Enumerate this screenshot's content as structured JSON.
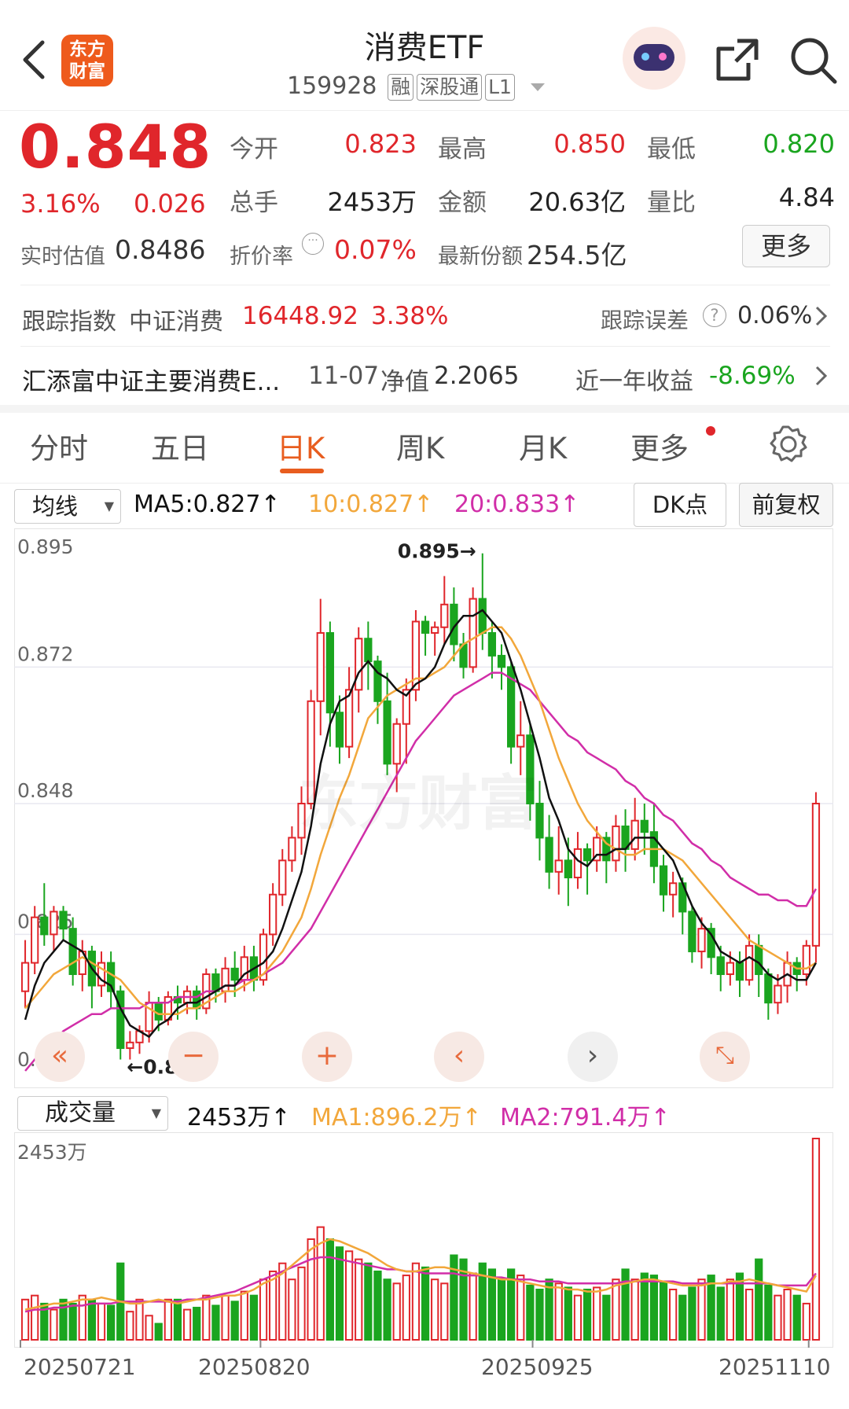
{
  "header": {
    "back_icon": "chevron-left-icon",
    "logo_line1": "东方",
    "logo_line2": "财富",
    "title": "消费ETF",
    "code": "159928",
    "tags": [
      "融",
      "深股通",
      "L1"
    ],
    "share_icon": "share-icon",
    "search_icon": "search-icon"
  },
  "quote": {
    "price": "0.848",
    "change_pct": "3.16%",
    "change_abs": "0.026",
    "open_label": "今开",
    "open": "0.823",
    "high_label": "最高",
    "high": "0.850",
    "low_label": "最低",
    "low": "0.820",
    "vol_label": "总手",
    "vol": "2453万",
    "amount_label": "金额",
    "amount": "20.63亿",
    "ratio_label": "量比",
    "ratio": "4.84",
    "iopv_label": "实时估值",
    "iopv": "0.8486",
    "discount_label": "折价率",
    "discount": "0.07%",
    "shares_label": "最新份额",
    "shares": "254.5亿",
    "more_button": "更多"
  },
  "tracking": {
    "label": "跟踪指数",
    "index_name": "中证消费",
    "index_value": "16448.92",
    "index_pct": "3.38%",
    "error_label": "跟踪误差",
    "error_value": "0.06%"
  },
  "fund": {
    "name": "汇添富中证主要消费E...",
    "nav_date": "11-07",
    "nav_label": "净值",
    "nav": "2.2065",
    "yr_label": "近一年收益",
    "yr_return": "-8.69%"
  },
  "tabs": [
    "分时",
    "五日",
    "日K",
    "周K",
    "月K",
    "更多"
  ],
  "active_tab": "日K",
  "ma_bar": {
    "select": "均线",
    "ma5": "MA5:0.827↑",
    "ma10": "10:0.827↑",
    "ma20": "20:0.833↑",
    "dk_button": "DK点",
    "fq_button": "前复权"
  },
  "volume_bar": {
    "select": "成交量",
    "vol": "2453万↑",
    "ma1": "MA1:896.2万↑",
    "ma2": "MA2:791.4万↑",
    "axis_top": "2453万"
  },
  "colors": {
    "up": "#e0262b",
    "down": "#1aa51f",
    "ma5": "#111111",
    "ma10": "#f2a73b",
    "ma20": "#d12ea8"
  },
  "chart_data": {
    "type": "candlestick",
    "y_ticks": [
      "0.895",
      "0.872",
      "0.848",
      "0.825",
      "0.801"
    ],
    "ylim": [
      0.801,
      0.895
    ],
    "high_annotation": "0.895→",
    "low_annotation": "←0.803",
    "x_labels": [
      "20250721",
      "20250820",
      "20250925",
      "20251110"
    ],
    "candles": [
      [
        0.815,
        0.82,
        0.812,
        0.824
      ],
      [
        0.82,
        0.828,
        0.818,
        0.83
      ],
      [
        0.828,
        0.825,
        0.823,
        0.834
      ],
      [
        0.825,
        0.829,
        0.822,
        0.83
      ],
      [
        0.829,
        0.826,
        0.824,
        0.83
      ],
      [
        0.826,
        0.818,
        0.816,
        0.828
      ],
      [
        0.818,
        0.822,
        0.815,
        0.824
      ],
      [
        0.822,
        0.816,
        0.812,
        0.823
      ],
      [
        0.816,
        0.82,
        0.814,
        0.822
      ],
      [
        0.82,
        0.815,
        0.812,
        0.822
      ],
      [
        0.815,
        0.805,
        0.803,
        0.816
      ],
      [
        0.805,
        0.806,
        0.803,
        0.808
      ],
      [
        0.806,
        0.808,
        0.804,
        0.809
      ],
      [
        0.808,
        0.813,
        0.806,
        0.815
      ],
      [
        0.813,
        0.81,
        0.808,
        0.814
      ],
      [
        0.81,
        0.814,
        0.809,
        0.815
      ],
      [
        0.814,
        0.813,
        0.81,
        0.816
      ],
      [
        0.813,
        0.815,
        0.811,
        0.816
      ],
      [
        0.815,
        0.812,
        0.81,
        0.816
      ],
      [
        0.812,
        0.818,
        0.811,
        0.819
      ],
      [
        0.818,
        0.815,
        0.813,
        0.819
      ],
      [
        0.815,
        0.819,
        0.813,
        0.821
      ],
      [
        0.819,
        0.817,
        0.814,
        0.822
      ],
      [
        0.817,
        0.821,
        0.815,
        0.823
      ],
      [
        0.821,
        0.817,
        0.815,
        0.823
      ],
      [
        0.817,
        0.825,
        0.816,
        0.826
      ],
      [
        0.825,
        0.832,
        0.823,
        0.834
      ],
      [
        0.832,
        0.838,
        0.83,
        0.84
      ],
      [
        0.838,
        0.842,
        0.836,
        0.844
      ],
      [
        0.842,
        0.848,
        0.839,
        0.851
      ],
      [
        0.848,
        0.866,
        0.847,
        0.868
      ],
      [
        0.866,
        0.878,
        0.86,
        0.884
      ],
      [
        0.878,
        0.864,
        0.858,
        0.88
      ],
      [
        0.864,
        0.858,
        0.855,
        0.867
      ],
      [
        0.858,
        0.868,
        0.856,
        0.872
      ],
      [
        0.868,
        0.877,
        0.864,
        0.879
      ],
      [
        0.877,
        0.873,
        0.868,
        0.88
      ],
      [
        0.873,
        0.866,
        0.862,
        0.874
      ],
      [
        0.866,
        0.855,
        0.853,
        0.871
      ],
      [
        0.855,
        0.862,
        0.85,
        0.863
      ],
      [
        0.862,
        0.868,
        0.855,
        0.87
      ],
      [
        0.868,
        0.88,
        0.866,
        0.882
      ],
      [
        0.88,
        0.878,
        0.874,
        0.881
      ],
      [
        0.878,
        0.879,
        0.874,
        0.88
      ],
      [
        0.879,
        0.883,
        0.876,
        0.888
      ],
      [
        0.883,
        0.876,
        0.873,
        0.886
      ],
      [
        0.876,
        0.872,
        0.87,
        0.878
      ],
      [
        0.872,
        0.884,
        0.871,
        0.886
      ],
      [
        0.884,
        0.878,
        0.875,
        0.892
      ],
      [
        0.878,
        0.874,
        0.87,
        0.88
      ],
      [
        0.874,
        0.872,
        0.868,
        0.876
      ],
      [
        0.872,
        0.858,
        0.855,
        0.873
      ],
      [
        0.858,
        0.86,
        0.853,
        0.866
      ],
      [
        0.86,
        0.848,
        0.845,
        0.862
      ],
      [
        0.848,
        0.842,
        0.838,
        0.852
      ],
      [
        0.842,
        0.836,
        0.833,
        0.846
      ],
      [
        0.836,
        0.838,
        0.832,
        0.844
      ],
      [
        0.838,
        0.835,
        0.83,
        0.842
      ],
      [
        0.835,
        0.84,
        0.833,
        0.843
      ],
      [
        0.84,
        0.838,
        0.832,
        0.841
      ],
      [
        0.838,
        0.842,
        0.836,
        0.844
      ],
      [
        0.842,
        0.838,
        0.834,
        0.843
      ],
      [
        0.838,
        0.844,
        0.836,
        0.846
      ],
      [
        0.844,
        0.84,
        0.836,
        0.847
      ],
      [
        0.84,
        0.845,
        0.838,
        0.849
      ],
      [
        0.845,
        0.843,
        0.839,
        0.848
      ],
      [
        0.843,
        0.837,
        0.834,
        0.848
      ],
      [
        0.837,
        0.832,
        0.829,
        0.839
      ],
      [
        0.832,
        0.834,
        0.828,
        0.836
      ],
      [
        0.834,
        0.829,
        0.825,
        0.835
      ],
      [
        0.829,
        0.822,
        0.82,
        0.83
      ],
      [
        0.822,
        0.826,
        0.819,
        0.828
      ],
      [
        0.826,
        0.821,
        0.818,
        0.827
      ],
      [
        0.821,
        0.818,
        0.815,
        0.823
      ],
      [
        0.818,
        0.82,
        0.816,
        0.822
      ],
      [
        0.82,
        0.817,
        0.814,
        0.822
      ],
      [
        0.817,
        0.823,
        0.816,
        0.825
      ],
      [
        0.823,
        0.818,
        0.814,
        0.825
      ],
      [
        0.818,
        0.813,
        0.81,
        0.819
      ],
      [
        0.813,
        0.816,
        0.811,
        0.818
      ],
      [
        0.816,
        0.82,
        0.813,
        0.822
      ],
      [
        0.82,
        0.818,
        0.815,
        0.821
      ],
      [
        0.818,
        0.823,
        0.816,
        0.824
      ],
      [
        0.823,
        0.848,
        0.82,
        0.85
      ]
    ],
    "ma5": [
      0.81,
      0.816,
      0.82,
      0.822,
      0.824,
      0.823,
      0.822,
      0.819,
      0.817,
      0.816,
      0.812,
      0.809,
      0.808,
      0.807,
      0.809,
      0.81,
      0.812,
      0.813,
      0.813,
      0.814,
      0.815,
      0.816,
      0.816,
      0.818,
      0.819,
      0.82,
      0.822,
      0.826,
      0.831,
      0.836,
      0.844,
      0.855,
      0.862,
      0.866,
      0.867,
      0.871,
      0.873,
      0.871,
      0.87,
      0.868,
      0.867,
      0.869,
      0.87,
      0.872,
      0.876,
      0.879,
      0.881,
      0.881,
      0.882,
      0.88,
      0.878,
      0.873,
      0.868,
      0.862,
      0.856,
      0.849,
      0.845,
      0.84,
      0.838,
      0.837,
      0.839,
      0.839,
      0.84,
      0.84,
      0.842,
      0.842,
      0.842,
      0.84,
      0.838,
      0.834,
      0.83,
      0.827,
      0.825,
      0.822,
      0.821,
      0.82,
      0.821,
      0.82,
      0.818,
      0.817,
      0.818,
      0.817,
      0.817,
      0.82
    ],
    "ma10": [
      0.812,
      0.814,
      0.816,
      0.818,
      0.819,
      0.82,
      0.821,
      0.82,
      0.819,
      0.818,
      0.817,
      0.815,
      0.813,
      0.812,
      0.811,
      0.811,
      0.811,
      0.812,
      0.812,
      0.813,
      0.814,
      0.815,
      0.815,
      0.816,
      0.817,
      0.818,
      0.82,
      0.822,
      0.825,
      0.828,
      0.833,
      0.839,
      0.844,
      0.849,
      0.853,
      0.858,
      0.863,
      0.865,
      0.867,
      0.868,
      0.869,
      0.87,
      0.87,
      0.871,
      0.872,
      0.874,
      0.876,
      0.877,
      0.878,
      0.879,
      0.879,
      0.877,
      0.874,
      0.87,
      0.866,
      0.861,
      0.856,
      0.852,
      0.848,
      0.845,
      0.843,
      0.841,
      0.84,
      0.839,
      0.839,
      0.84,
      0.84,
      0.84,
      0.839,
      0.838,
      0.836,
      0.834,
      0.832,
      0.83,
      0.828,
      0.826,
      0.824,
      0.823,
      0.822,
      0.821,
      0.82,
      0.819,
      0.819,
      0.82
    ],
    "ma20": [
      0.801,
      0.803,
      0.805,
      0.806,
      0.808,
      0.809,
      0.81,
      0.811,
      0.811,
      0.812,
      0.812,
      0.812,
      0.812,
      0.813,
      0.813,
      0.813,
      0.814,
      0.814,
      0.814,
      0.815,
      0.815,
      0.816,
      0.816,
      0.817,
      0.817,
      0.818,
      0.819,
      0.82,
      0.822,
      0.824,
      0.826,
      0.829,
      0.832,
      0.835,
      0.838,
      0.841,
      0.844,
      0.847,
      0.85,
      0.853,
      0.856,
      0.859,
      0.861,
      0.863,
      0.865,
      0.867,
      0.868,
      0.869,
      0.87,
      0.871,
      0.871,
      0.87,
      0.869,
      0.868,
      0.866,
      0.864,
      0.862,
      0.86,
      0.859,
      0.857,
      0.856,
      0.855,
      0.854,
      0.852,
      0.851,
      0.849,
      0.848,
      0.846,
      0.845,
      0.843,
      0.841,
      0.84,
      0.838,
      0.837,
      0.835,
      0.834,
      0.833,
      0.832,
      0.832,
      0.831,
      0.831,
      0.83,
      0.83,
      0.833
    ],
    "volume": [
      0.2,
      0.22,
      0.18,
      0.15,
      0.2,
      0.18,
      0.22,
      0.2,
      0.18,
      0.17,
      0.38,
      0.14,
      0.2,
      0.12,
      0.08,
      0.2,
      0.2,
      0.15,
      0.16,
      0.22,
      0.17,
      0.22,
      0.19,
      0.24,
      0.22,
      0.3,
      0.34,
      0.38,
      0.3,
      0.36,
      0.5,
      0.56,
      0.5,
      0.46,
      0.44,
      0.4,
      0.38,
      0.34,
      0.3,
      0.28,
      0.32,
      0.38,
      0.36,
      0.3,
      0.28,
      0.42,
      0.4,
      0.33,
      0.38,
      0.35,
      0.3,
      0.35,
      0.32,
      0.27,
      0.25,
      0.3,
      0.28,
      0.26,
      0.22,
      0.25,
      0.26,
      0.22,
      0.3,
      0.35,
      0.3,
      0.33,
      0.32,
      0.29,
      0.25,
      0.22,
      0.26,
      0.3,
      0.32,
      0.26,
      0.3,
      0.33,
      0.25,
      0.4,
      0.27,
      0.22,
      0.25,
      0.22,
      0.18,
      1.0
    ],
    "volume_ma1": [
      0.15,
      0.16,
      0.17,
      0.18,
      0.18,
      0.19,
      0.2,
      0.2,
      0.21,
      0.2,
      0.19,
      0.18,
      0.18,
      0.19,
      0.2,
      0.19,
      0.18,
      0.19,
      0.2,
      0.2,
      0.21,
      0.22,
      0.22,
      0.23,
      0.25,
      0.28,
      0.3,
      0.33,
      0.37,
      0.41,
      0.45,
      0.48,
      0.5,
      0.49,
      0.47,
      0.45,
      0.43,
      0.4,
      0.37,
      0.35,
      0.34,
      0.34,
      0.35,
      0.36,
      0.36,
      0.35,
      0.34,
      0.33,
      0.32,
      0.31,
      0.3,
      0.3,
      0.29,
      0.28,
      0.27,
      0.26,
      0.26,
      0.25,
      0.25,
      0.24,
      0.24,
      0.25,
      0.27,
      0.28,
      0.29,
      0.3,
      0.3,
      0.29,
      0.28,
      0.27,
      0.27,
      0.27,
      0.28,
      0.28,
      0.29,
      0.29,
      0.3,
      0.29,
      0.28,
      0.27,
      0.26,
      0.25,
      0.24,
      0.32
    ],
    "volume_ma2": [
      0.14,
      0.15,
      0.15,
      0.16,
      0.16,
      0.17,
      0.17,
      0.18,
      0.18,
      0.18,
      0.19,
      0.19,
      0.19,
      0.19,
      0.19,
      0.19,
      0.19,
      0.2,
      0.2,
      0.21,
      0.22,
      0.23,
      0.24,
      0.26,
      0.28,
      0.3,
      0.32,
      0.34,
      0.36,
      0.38,
      0.4,
      0.41,
      0.41,
      0.4,
      0.39,
      0.38,
      0.37,
      0.36,
      0.35,
      0.35,
      0.34,
      0.34,
      0.33,
      0.33,
      0.33,
      0.33,
      0.32,
      0.32,
      0.32,
      0.31,
      0.31,
      0.3,
      0.3,
      0.3,
      0.29,
      0.29,
      0.29,
      0.28,
      0.28,
      0.28,
      0.28,
      0.28,
      0.28,
      0.29,
      0.29,
      0.29,
      0.29,
      0.29,
      0.29,
      0.28,
      0.28,
      0.28,
      0.28,
      0.28,
      0.28,
      0.28,
      0.28,
      0.28,
      0.28,
      0.27,
      0.27,
      0.27,
      0.27,
      0.33
    ]
  }
}
